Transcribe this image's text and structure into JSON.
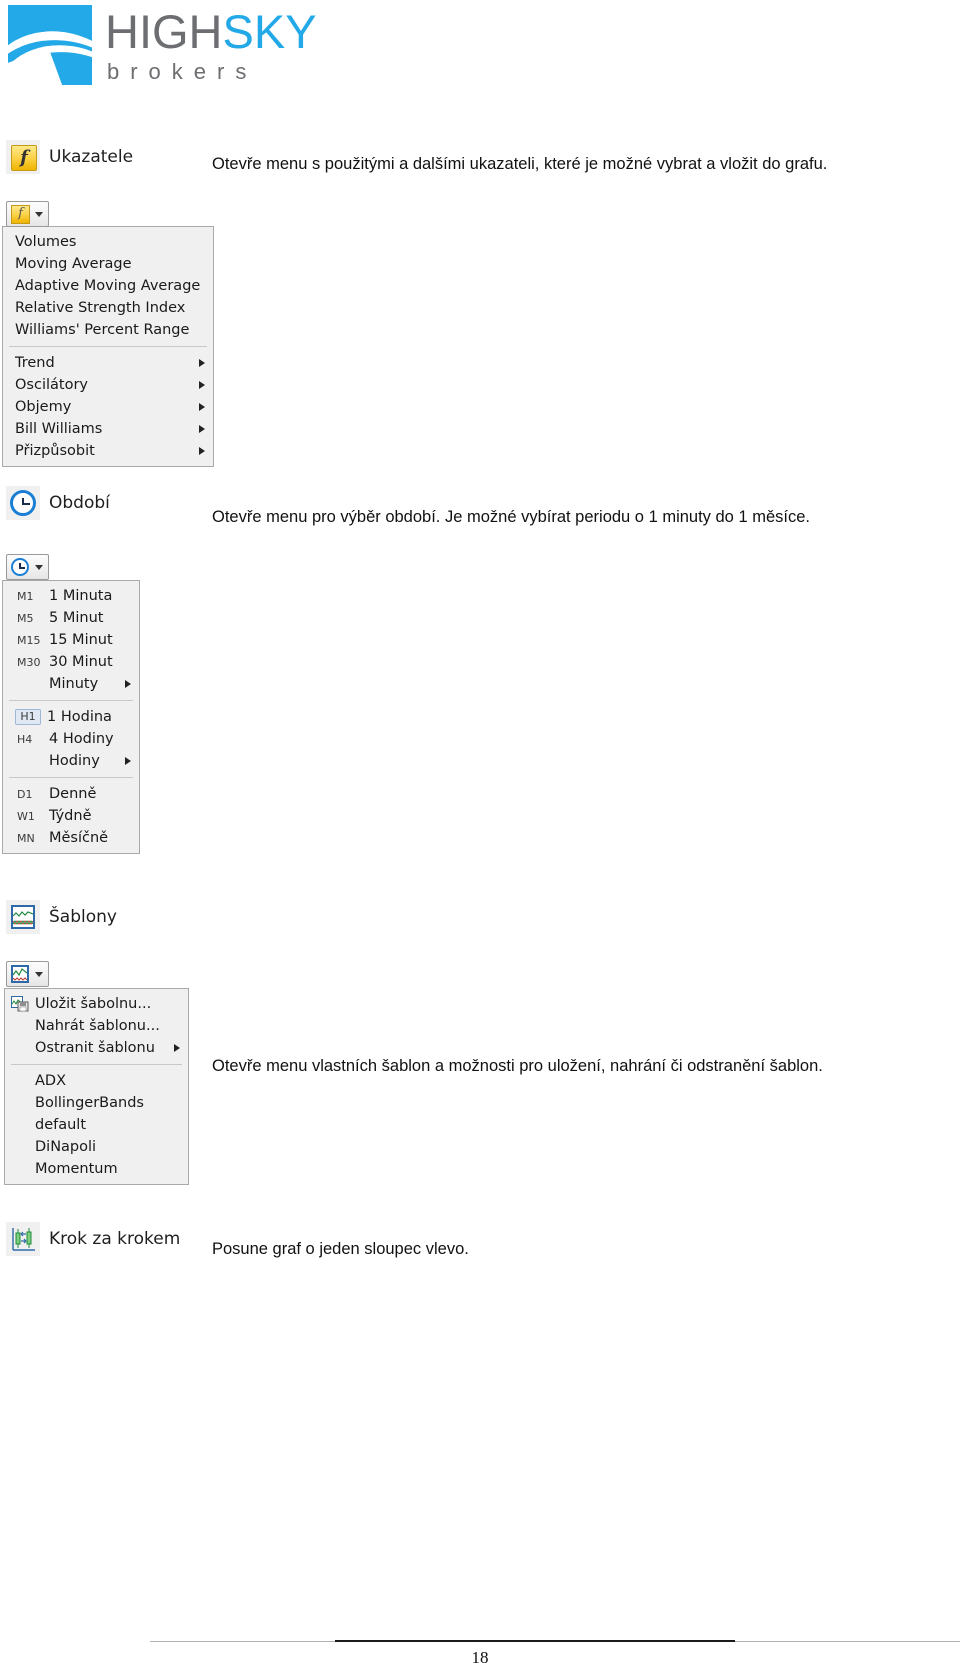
{
  "logo": {
    "word_part1": "HIGH",
    "word_part2": "SKY",
    "subtitle": "brokers",
    "brand_blue": "#23a8e8",
    "brand_gray": "#6d6e71"
  },
  "sections": [
    {
      "id": "indicators",
      "icon": "function-f-icon",
      "caption": "Ukazatele",
      "description": "Otevře menu s použitými a dalšími ukazateli, které je možné vybrat a vložit do grafu.",
      "menu": {
        "items": [
          {
            "label": "Volumes",
            "submenu": false
          },
          {
            "label": "Moving Average",
            "submenu": false
          },
          {
            "label": "Adaptive Moving Average",
            "submenu": false
          },
          {
            "label": "Relative Strength Index",
            "submenu": false
          },
          {
            "label": "Williams' Percent Range",
            "submenu": false
          },
          {
            "separator": true
          },
          {
            "label": "Trend",
            "submenu": true
          },
          {
            "label": "Oscilátory",
            "submenu": true
          },
          {
            "label": "Objemy",
            "submenu": true
          },
          {
            "label": "Bill Williams",
            "submenu": true
          },
          {
            "label": "Přizpůsobit",
            "submenu": true
          }
        ]
      }
    },
    {
      "id": "period",
      "icon": "clock-icon",
      "caption": "Období",
      "description": "Otevře menu pro výběr období. Je možné vybírat periodu o 1 minuty do 1 měsíce.",
      "menu": {
        "items": [
          {
            "code": "M1",
            "label": "1 Minuta",
            "submenu": false,
            "selected": false
          },
          {
            "code": "M5",
            "label": "5 Minut",
            "submenu": false,
            "selected": false
          },
          {
            "code": "M15",
            "label": "15 Minut",
            "submenu": false,
            "selected": false
          },
          {
            "code": "M30",
            "label": "30 Minut",
            "submenu": false,
            "selected": false
          },
          {
            "code": "",
            "label": "Minuty",
            "submenu": true,
            "selected": false
          },
          {
            "separator": true
          },
          {
            "code": "H1",
            "label": "1 Hodina",
            "submenu": false,
            "selected": true
          },
          {
            "code": "H4",
            "label": "4 Hodiny",
            "submenu": false,
            "selected": false
          },
          {
            "code": "",
            "label": "Hodiny",
            "submenu": true,
            "selected": false
          },
          {
            "separator": true
          },
          {
            "code": "D1",
            "label": "Denně",
            "submenu": false,
            "selected": false
          },
          {
            "code": "W1",
            "label": "Týdně",
            "submenu": false,
            "selected": false
          },
          {
            "code": "MN",
            "label": "Měsíčně",
            "submenu": false,
            "selected": false
          }
        ]
      }
    },
    {
      "id": "templates",
      "icon": "chart-template-icon",
      "caption": "Šablony",
      "description": "Otevře menu vlastních šablon a možnosti pro uložení, nahrání či odstranění šablon.",
      "menu": {
        "items": [
          {
            "label": "Uložit šabolnu...",
            "submenu": false,
            "icon": "save-template-icon"
          },
          {
            "label": "Nahrát šablonu...",
            "submenu": false
          },
          {
            "label": "Ostranit šablonu",
            "submenu": true
          },
          {
            "separator": true
          },
          {
            "label": "ADX",
            "submenu": false
          },
          {
            "label": "BollingerBands",
            "submenu": false
          },
          {
            "label": "default",
            "submenu": false
          },
          {
            "label": "DiNapoli",
            "submenu": false
          },
          {
            "label": "Momentum",
            "submenu": false
          }
        ]
      }
    },
    {
      "id": "step-by-step",
      "icon": "step-by-step-icon",
      "caption": "Krok za krokem",
      "description": "Posune graf o jeden sloupec vlevo.",
      "menu": null
    }
  ],
  "footer": {
    "page_number": "18"
  }
}
